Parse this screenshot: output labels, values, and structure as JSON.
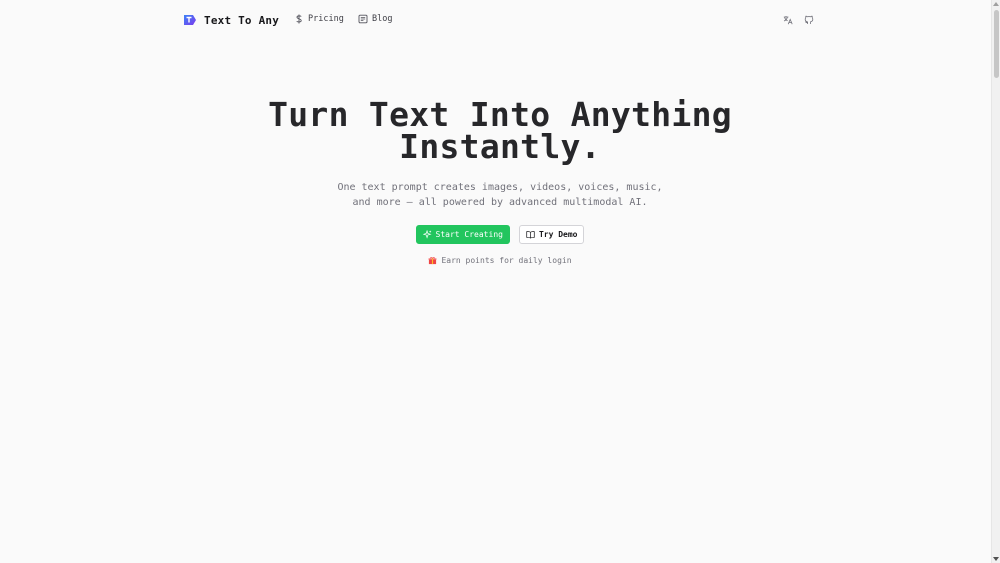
{
  "header": {
    "logo_text": "Text To Any",
    "nav": [
      {
        "label": "Pricing",
        "icon": "dollar-icon"
      },
      {
        "label": "Blog",
        "icon": "newspaper-icon"
      }
    ],
    "icons": [
      "translate-icon",
      "github-icon"
    ]
  },
  "hero": {
    "title_line1": "Turn Text Into Anything",
    "title_line2": "Instantly.",
    "subtitle_line1": "One text prompt creates images, videos, voices, music,",
    "subtitle_line2": "and more — all powered by advanced multimodal AI.",
    "primary_button": "Start Creating",
    "secondary_button": "Try Demo",
    "reward_text": "Earn points for daily login"
  },
  "colors": {
    "accent": "#22c55e",
    "background": "#fafafa",
    "logo_blue": "#3b82f6",
    "logo_purple": "#7c3aed",
    "gift": "#ef4444"
  }
}
